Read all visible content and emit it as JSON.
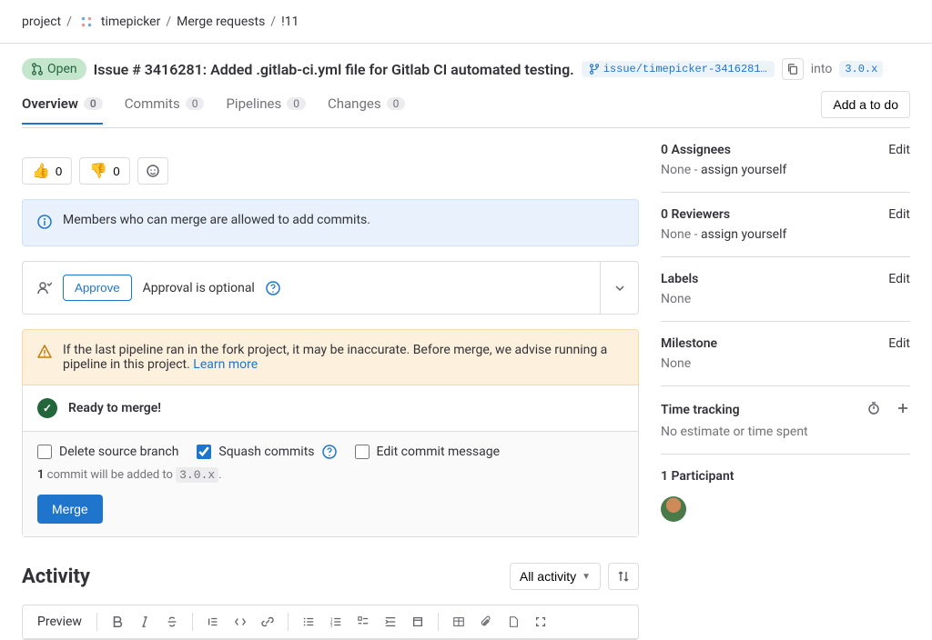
{
  "breadcrumb": {
    "items": [
      {
        "label": "project"
      },
      {
        "label": "timepicker",
        "hasIcon": true
      },
      {
        "label": "Merge requests"
      },
      {
        "label": "!11"
      }
    ]
  },
  "header": {
    "status": "Open",
    "title": "Issue # 3416281: Added .gitlab-ci.yml file for Gitlab CI automated testing.",
    "sourceBranch": "issue/timepicker-3416281…",
    "intoLabel": "into",
    "targetBranch": "3.0.x"
  },
  "tabs": {
    "addTodo": "Add a to do",
    "items": [
      {
        "label": "Overview",
        "count": "0",
        "active": true
      },
      {
        "label": "Commits",
        "count": "0"
      },
      {
        "label": "Pipelines",
        "count": "0"
      },
      {
        "label": "Changes",
        "count": "0"
      }
    ]
  },
  "reactions": {
    "up": {
      "emoji": "👍",
      "count": "0"
    },
    "down": {
      "emoji": "👎",
      "count": "0"
    }
  },
  "infoNotice": "Members who can merge are allowed to add commits.",
  "approval": {
    "approveBtn": "Approve",
    "optionalText": "Approval is optional"
  },
  "pipelineWarning": {
    "text": "If the last pipeline ran in the fork project, it may be inaccurate. Before merge, we advise running a pipeline in this project. ",
    "link": "Learn more"
  },
  "merge": {
    "readyText": "Ready to merge!",
    "deleteSource": "Delete source branch",
    "squash": "Squash commits",
    "editMsg": "Edit commit message",
    "deleteChecked": false,
    "squashChecked": true,
    "editChecked": false,
    "commitNoteBold": "1",
    "commitNoteRest": " commit will be added to ",
    "commitNoteBranch": "3.0.x",
    "mergeBtn": "Merge"
  },
  "activity": {
    "heading": "Activity",
    "allActivity": "All activity",
    "previewTab": "Preview"
  },
  "sidebar": {
    "assignees": {
      "title": "0 Assignees",
      "value": "None - ",
      "link": "assign yourself",
      "edit": "Edit"
    },
    "reviewers": {
      "title": "0 Reviewers",
      "value": "None - ",
      "link": "assign yourself",
      "edit": "Edit"
    },
    "labels": {
      "title": "Labels",
      "value": "None",
      "edit": "Edit"
    },
    "milestone": {
      "title": "Milestone",
      "value": "None",
      "edit": "Edit"
    },
    "timeTracking": {
      "title": "Time tracking",
      "value": "No estimate or time spent"
    },
    "participants": {
      "title": "1 Participant"
    }
  }
}
